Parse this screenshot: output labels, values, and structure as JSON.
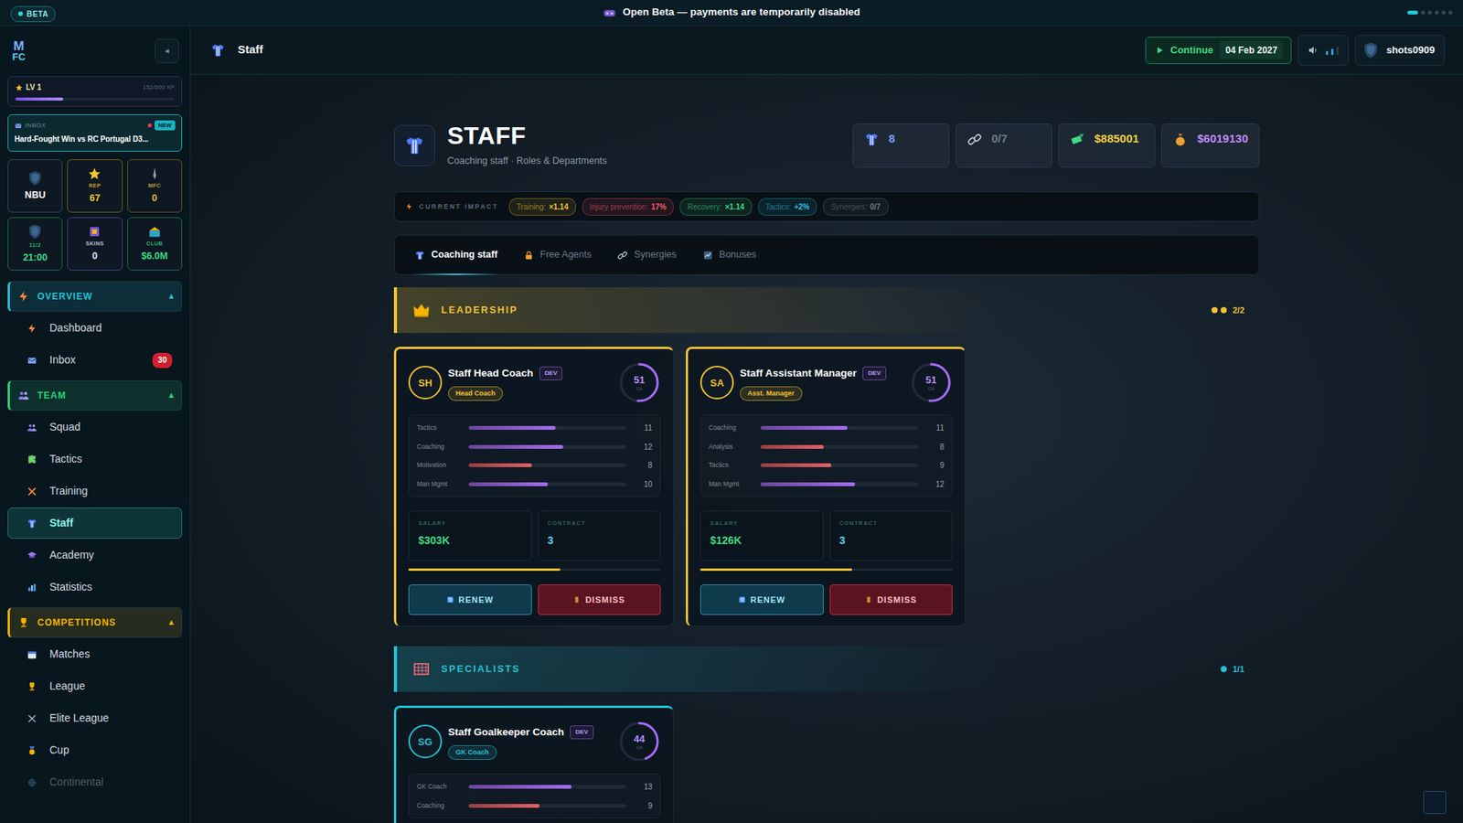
{
  "beta_bar": {
    "badge": "BETA",
    "message": "Open Beta — payments are temporarily disabled",
    "dots": [
      {
        "selected": true
      },
      {
        "selected": false
      },
      {
        "selected": false
      },
      {
        "selected": false
      },
      {
        "selected": false
      },
      {
        "selected": false
      }
    ]
  },
  "sidebar": {
    "logo_top": "M",
    "logo_bottom": "FC",
    "collapse": "◂",
    "level": {
      "label": "LV 1",
      "xp": "152/500 XP",
      "level": 0.3
    },
    "inbox": {
      "label": "INBOX",
      "badge": "NEW",
      "title": "Hard-Fought Win vs RC Portugal D3..."
    },
    "tiles": [
      {
        "kind": "crest",
        "value": "NBU",
        "color": "#34465a",
        "value_color": "#ffffff"
      },
      {
        "kind": "star",
        "label": "REP",
        "value": "67",
        "color": "#7a5e1e",
        "value_color": "#f4c430"
      },
      {
        "kind": "quill",
        "label": "MFC",
        "value": "0",
        "color": "#5e5230",
        "value_color": "#e8b84a"
      },
      {
        "kind": "crest",
        "label": "11/2",
        "value": "21:00",
        "color": "#1f6a45",
        "value_color": "#3ddc84"
      },
      {
        "kind": "skins",
        "label": "SKINS",
        "value": "0",
        "color": "#4a3a8a",
        "value_color": "#e6e0ff"
      },
      {
        "kind": "club",
        "label": "CLUB",
        "value": "$6.0M",
        "color": "#1f6a45",
        "value_color": "#3ddc84"
      }
    ],
    "sections": [
      {
        "title": "OVERVIEW",
        "toggle": "▲",
        "expanded": true,
        "color": "#22c3d6",
        "items": [
          {
            "label": "Dashboard",
            "selected": false,
            "disabled": false
          },
          {
            "label": "Inbox",
            "badge": "30",
            "selected": false,
            "disabled": false
          }
        ]
      },
      {
        "title": "TEAM",
        "toggle": "▲",
        "expanded": true,
        "color": "#2bd47a",
        "items": [
          {
            "label": "Squad",
            "selected": false,
            "disabled": false
          },
          {
            "label": "Tactics",
            "selected": false,
            "disabled": false
          },
          {
            "label": "Training",
            "selected": false,
            "disabled": false
          },
          {
            "label": "Staff",
            "selected": true,
            "disabled": false
          },
          {
            "label": "Academy",
            "selected": false,
            "disabled": false
          },
          {
            "label": "Statistics",
            "selected": false,
            "disabled": false
          }
        ]
      },
      {
        "title": "COMPETITIONS",
        "toggle": "▲",
        "expanded": true,
        "color": "#f4b400",
        "items": [
          {
            "label": "Matches",
            "selected": false,
            "disabled": false
          },
          {
            "label": "League",
            "selected": false,
            "disabled": false
          },
          {
            "label": "Elite League",
            "selected": false,
            "disabled": false
          },
          {
            "label": "Cup",
            "selected": false,
            "disabled": false
          },
          {
            "label": "Continental",
            "selected": false,
            "disabled": true
          }
        ]
      }
    ]
  },
  "header": {
    "title": "Staff",
    "continue_label": "Continue",
    "date": "04 Feb 2027",
    "volume": 0.67,
    "user": "shots0909"
  },
  "page": {
    "title": "STAFF",
    "subtitle": "Coaching staff · Roles & Departments",
    "stats": [
      {
        "value": "8",
        "color": "#7aa2ff"
      },
      {
        "value": "0/7",
        "color": "#6c7a89"
      },
      {
        "value": "$885001",
        "color": "#f4d03f"
      },
      {
        "value": "$6019130",
        "color": "#c58cff"
      }
    ],
    "impact": {
      "label": "CURRENT IMPACT",
      "chips": [
        {
          "label": "Training:",
          "value": "×1.14",
          "color": "#f4c430"
        },
        {
          "label": "Injury prevention:",
          "value": "17%",
          "color": "#ff5a6a"
        },
        {
          "label": "Recovery:",
          "value": "×1.14",
          "color": "#3ddc84"
        },
        {
          "label": "Tactics:",
          "value": "+2%",
          "color": "#2ac4e0"
        },
        {
          "label": "Synergies:",
          "value": "0/7",
          "color": "#6c7a89"
        }
      ]
    },
    "tabs": [
      {
        "label": "Coaching staff",
        "selected": true
      },
      {
        "label": "Free Agents",
        "selected": false
      },
      {
        "label": "Synergies",
        "selected": false
      },
      {
        "label": "Bonuses",
        "selected": false
      }
    ],
    "groups": [
      {
        "title": "LEADERSHIP",
        "count": "2/2",
        "color": "#f4c430",
        "dots": [
          {
            "on": true
          },
          {
            "on": true
          }
        ],
        "cards": [
          {
            "initials": "SH",
            "name": "Staff Head Coach",
            "badge": "DEV",
            "role": "Head Coach",
            "rating": "51",
            "rating_label": "CA",
            "rating_level": 0.51,
            "attributes": [
              {
                "label": "Tactics",
                "value": "11",
                "level": 0.55,
                "color": "#a56cf0"
              },
              {
                "label": "Coaching",
                "value": "12",
                "level": 0.6,
                "color": "#a56cf0"
              },
              {
                "label": "Motivation",
                "value": "8",
                "level": 0.4,
                "color": "#e8606a"
              },
              {
                "label": "Man Mgmt",
                "value": "10",
                "level": 0.5,
                "color": "#a56cf0"
              }
            ],
            "salary_label": "SALARY",
            "salary": "$303K",
            "contract_label": "CONTRACT",
            "contract": "3",
            "progress": 0.6,
            "renew": "RENEW",
            "dismiss": "DISMISS"
          },
          {
            "initials": "SA",
            "name": "Staff Assistant Manager",
            "badge": "DEV",
            "role": "Asst. Manager",
            "rating": "51",
            "rating_label": "CA",
            "rating_level": 0.51,
            "attributes": [
              {
                "label": "Coaching",
                "value": "11",
                "level": 0.55,
                "color": "#a56cf0"
              },
              {
                "label": "Analysis",
                "value": "8",
                "level": 0.4,
                "color": "#e8606a"
              },
              {
                "label": "Tactics",
                "value": "9",
                "level": 0.45,
                "color": "#e8606a"
              },
              {
                "label": "Man Mgmt",
                "value": "12",
                "level": 0.6,
                "color": "#a56cf0"
              }
            ],
            "salary_label": "SALARY",
            "salary": "$126K",
            "contract_label": "CONTRACT",
            "contract": "3",
            "progress": 0.6,
            "renew": "RENEW",
            "dismiss": "DISMISS"
          }
        ]
      },
      {
        "title": "SPECIALISTS",
        "count": "1/1",
        "color": "#22c3d6",
        "dots": [
          {
            "on": true
          }
        ],
        "cards": [
          {
            "initials": "SG",
            "name": "Staff Goalkeeper Coach",
            "badge": "DEV",
            "role": "GK Coach",
            "rating": "44",
            "rating_label": "CA",
            "rating_level": 0.44,
            "attributes": [
              {
                "label": "GK Coach",
                "value": "13",
                "level": 0.65,
                "color": "#a56cf0"
              },
              {
                "label": "Coaching",
                "value": "9",
                "level": 0.45,
                "color": "#e8606a"
              }
            ]
          }
        ]
      }
    ]
  }
}
